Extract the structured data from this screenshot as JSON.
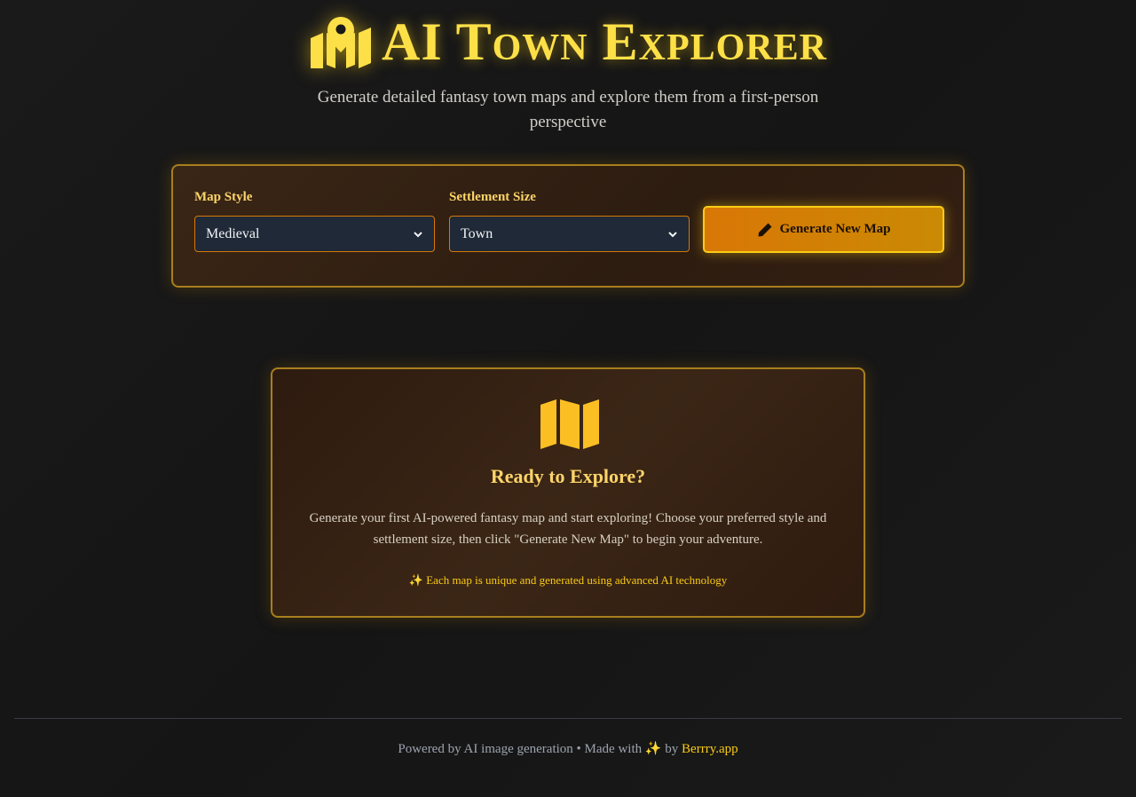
{
  "header": {
    "title": "AI Town Explorer",
    "icon": "map-location-icon",
    "subtitle": "Generate detailed fantasy town maps and explore them from a first-person perspective"
  },
  "controls": {
    "map_style": {
      "label": "Map Style",
      "value": "Medieval"
    },
    "settlement_size": {
      "label": "Settlement Size",
      "value": "Town"
    },
    "generate_button": {
      "label": "Generate New Map",
      "icon": "pencil-icon"
    }
  },
  "card": {
    "icon": "map-icon",
    "title": "Ready to Explore?",
    "description": "Generate your first AI-powered fantasy map and start exploring! Choose your preferred style and settlement size, then click \"Generate New Map\" to begin your adventure.",
    "note": "✨ Each map is unique and generated using advanced AI technology"
  },
  "footer": {
    "text": "Powered by AI image generation • Made with ✨ by",
    "link": "Berrry.app"
  },
  "colors": {
    "accent": "#facc15",
    "title": "#fde047",
    "button": "#d97706",
    "panel_border": "#a87f1e"
  }
}
